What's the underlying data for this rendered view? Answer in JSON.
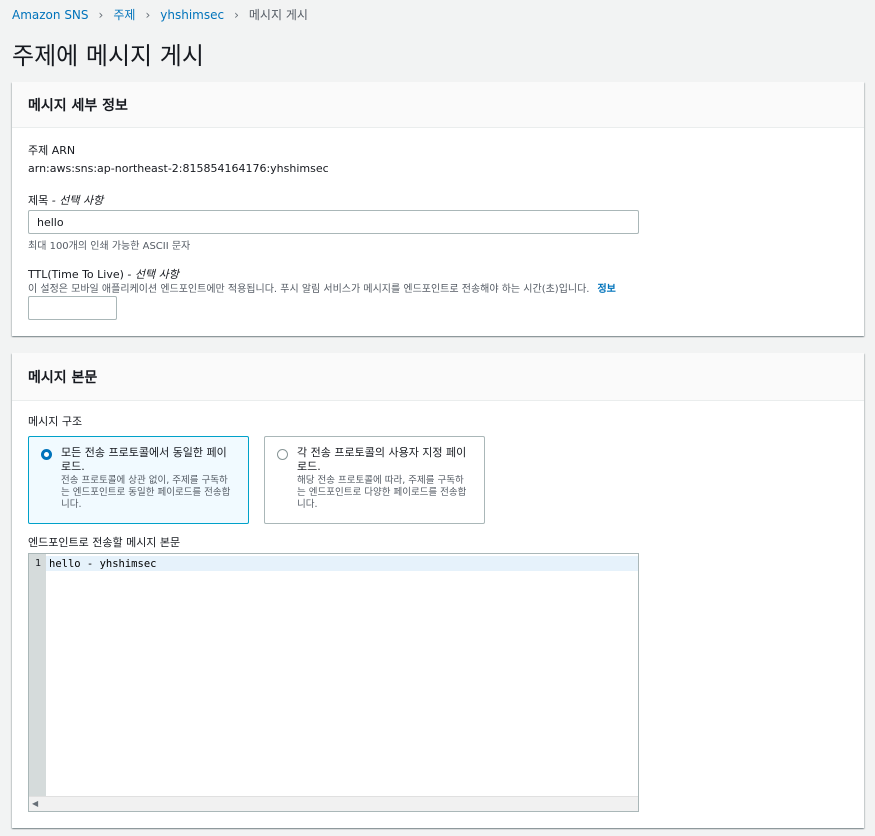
{
  "breadcrumb": {
    "items": [
      "Amazon SNS",
      "주제",
      "yhshimsec"
    ],
    "current": "메시지 게시"
  },
  "page_title": "주제에 메시지 게시",
  "details": {
    "header": "메시지 세부 정보",
    "arn_label": "주제 ARN",
    "arn_value": "arn:aws:sns:ap-northeast-2:815854164176:yhshimsec",
    "subject_label": "제목",
    "subject_optional": "- 선택 사항",
    "subject_value": "hello",
    "subject_hint": "최대 100개의 인쇄 가능한 ASCII 문자",
    "ttl_label": "TTL(Time To Live)",
    "ttl_optional": "- 선택 사항",
    "ttl_hint": "이 설정은 모바일 애플리케이션 엔드포인트에만 적용됩니다. 푸시 알림 서비스가 메시지를 엔드포인트로 전송해야 하는 시간(초)입니다.",
    "ttl_info": "정보",
    "ttl_value": ""
  },
  "body_panel": {
    "header": "메시지 본문",
    "structure_label": "메시지 구조",
    "options": [
      {
        "title": "모든 전송 프로토콜에서 동일한 페이로드.",
        "desc": "전송 프로토콜에 상관 없이, 주제를 구독하는 엔드포인트로 동일한 페이로드를 전송합니다.",
        "selected": true
      },
      {
        "title": "각 전송 프로토콜의 사용자 지정 페이로드.",
        "desc": "해당 전송 프로토콜에 따라, 주제를 구독하는 엔드포인트로 다양한 페이로드를 전송합니다.",
        "selected": false
      }
    ],
    "editor_label": "엔드포인트로 전송할 메시지 본문",
    "editor_line_number": "1",
    "editor_text": "hello - yhshimsec"
  },
  "colors": {
    "link": "#0073bb",
    "selected_border": "#00a1c9",
    "selected_bg": "#f1faff"
  }
}
